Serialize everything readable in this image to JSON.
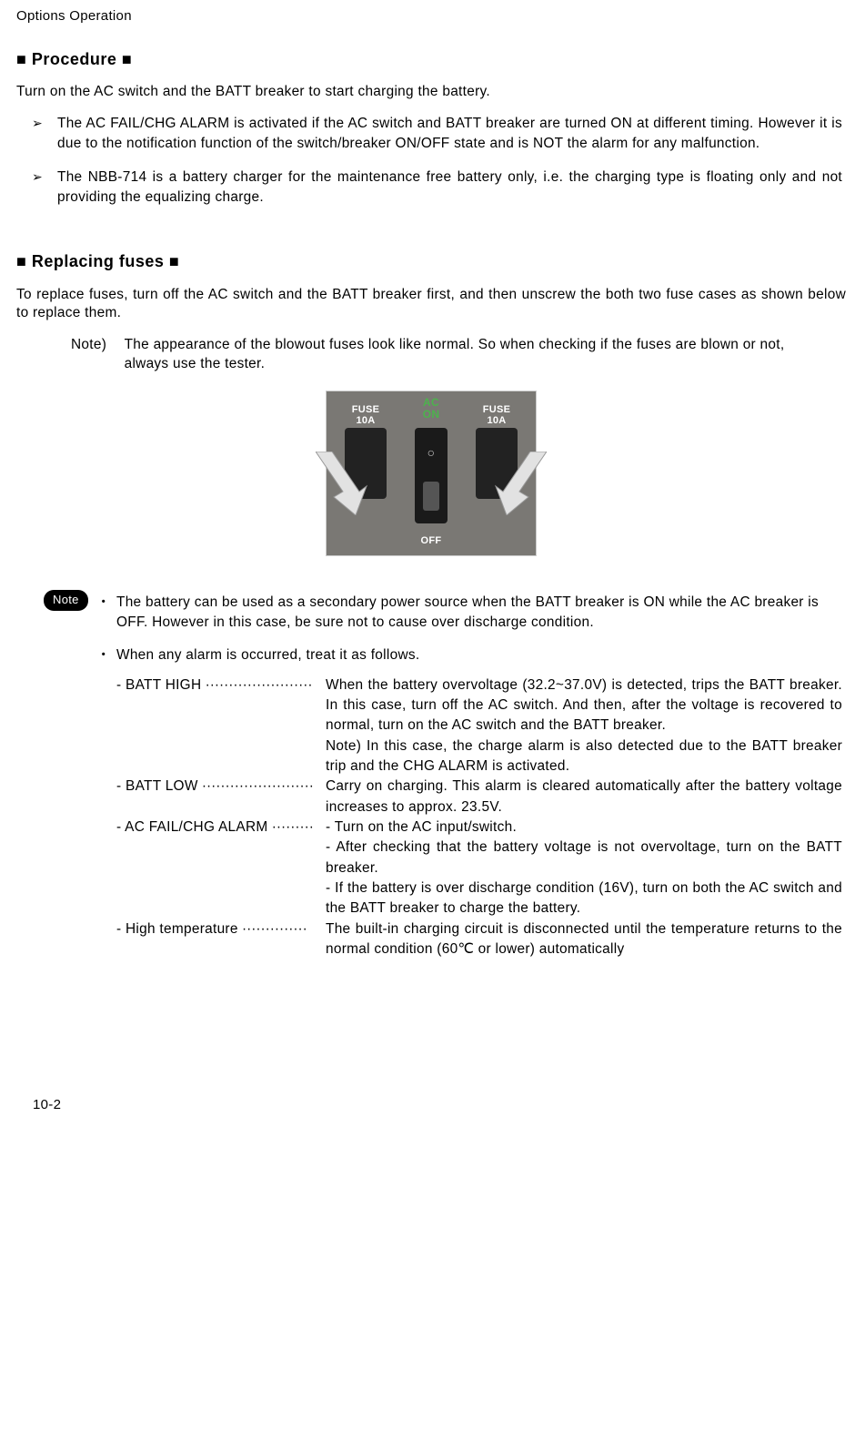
{
  "header": "Options Operation",
  "sections": {
    "procedure": {
      "title": "■ Procedure ■",
      "intro": "Turn on the AC switch and the BATT breaker to start charging the battery.",
      "bullets": [
        "The AC FAIL/CHG ALARM is activated if the AC switch and BATT breaker are turned ON at different timing. However it is due to the notification function of the switch/breaker ON/OFF state and is NOT the alarm for any malfunction.",
        "The NBB-714 is a battery charger for the maintenance free battery only, i.e. the charging type is floating only and not providing the equalizing charge."
      ]
    },
    "replacing": {
      "title": "■ Replacing fuses ■",
      "intro": "To replace fuses, turn off the AC switch and the BATT breaker first, and then unscrew the both two fuse cases as shown below to replace them.",
      "note_label": "Note)",
      "note_text": "The appearance of the blowout fuses look like normal. So when checking if the fuses are blown or not, always use the tester.",
      "fig": {
        "fuse_left": "FUSE\n10A",
        "fuse_right": "FUSE\n10A",
        "ac": "AC\nON",
        "off": "OFF"
      }
    },
    "note_block": {
      "pill": "Note",
      "items": [
        "The battery can be used as a secondary power source when the BATT breaker is ON while the AC breaker is OFF. However in this case, be sure not to cause over discharge condition.",
        "When any alarm is occurred, treat it as follows."
      ],
      "alarms": [
        {
          "label": "- BATT HIGH",
          "dots": " ·······················",
          "desc": "When the battery overvoltage (32.2~37.0V) is detected, trips the BATT breaker. In this case, turn off the AC switch. And then, after the voltage is recovered to normal, turn on the AC switch and the BATT breaker.\nNote) In this case, the charge alarm is also detected due to the BATT breaker trip and the CHG ALARM is activated."
        },
        {
          "label": "- BATT LOW",
          "dots": " ························",
          "desc": "Carry on charging. This alarm is cleared automatically after the battery voltage increases to approx. 23.5V."
        },
        {
          "label": "- AC FAIL/CHG ALARM",
          "dots": " ·········",
          "desc": "- Turn on the AC input/switch.\n- After checking that the battery voltage is not overvoltage, turn on the BATT breaker.\n- If the battery is over discharge condition (16V), turn on both the AC switch and the BATT breaker to charge the battery."
        },
        {
          "label": "- High temperature",
          "dots": " ··············",
          "desc": "The built-in charging circuit is disconnected until the temperature returns to the normal condition (60℃ or lower) automatically"
        }
      ]
    }
  },
  "page_number": "10-2"
}
